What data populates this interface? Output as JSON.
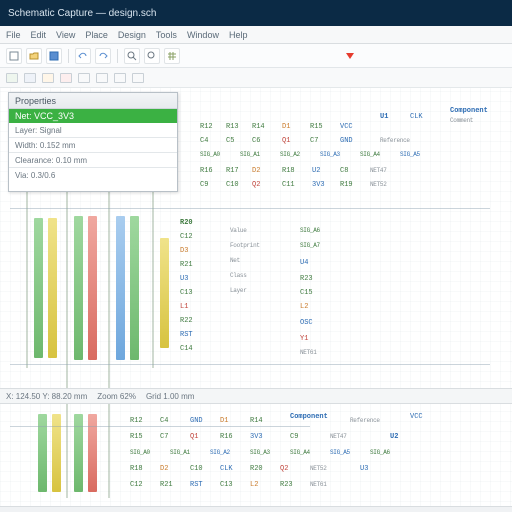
{
  "window": {
    "title": "Schematic Capture — design.sch"
  },
  "menu": {
    "items": [
      "File",
      "Edit",
      "View",
      "Place",
      "Design",
      "Tools",
      "Window",
      "Help"
    ]
  },
  "toolbar": {
    "marker_tip": "cursor"
  },
  "panel": {
    "title": "Properties",
    "highlight": "Net: VCC_3V3",
    "rows": [
      "Layer: Signal",
      "Width: 0.152 mm",
      "Clearance: 0.10 mm",
      "Via: 0.3/0.6"
    ]
  },
  "status": {
    "coords": "X: 124.50  Y: 88.20 mm",
    "zoom": "Zoom 62%",
    "grid": "Grid 1.00 mm"
  },
  "labels": {
    "a": [
      "R12",
      "R13",
      "R14",
      "R15",
      "R16",
      "R17",
      "R18",
      "R19",
      "R20",
      "R21",
      "R22",
      "R23"
    ],
    "b": [
      "C4",
      "C5",
      "C6",
      "C7",
      "C8",
      "C9",
      "C10",
      "C11",
      "C12",
      "C13",
      "C14",
      "C15"
    ],
    "c": [
      "U1",
      "U2",
      "U3",
      "U4"
    ],
    "d": [
      "GND",
      "VCC",
      "3V3",
      "CLK",
      "RST",
      "OSC",
      "NET47",
      "NET52",
      "NET61"
    ],
    "e": [
      "D1",
      "D2",
      "D3",
      "Q1",
      "Q2",
      "L1",
      "L2",
      "Y1"
    ],
    "f": [
      "Component",
      "Comment",
      "Reference",
      "Value",
      "Footprint",
      "Net",
      "Class",
      "Layer"
    ],
    "g": [
      "SIG_A0",
      "SIG_A1",
      "SIG_A2",
      "SIG_A3",
      "SIG_A4",
      "SIG_A5",
      "SIG_A6",
      "SIG_A7"
    ]
  }
}
